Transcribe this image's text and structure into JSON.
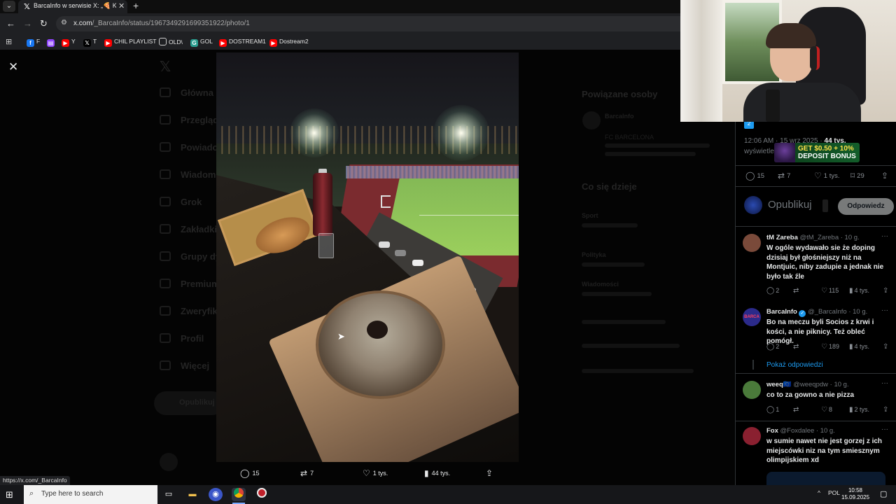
{
  "browser": {
    "tab_title": "BarcaInfo w serwisie X: „🍕 Kib",
    "new_tab_label": "+",
    "url_domain": "x.com",
    "url_path": "/_BarcaInfo/status/1967349291699351922/photo/1",
    "bookmarks": [
      {
        "label": "F",
        "icon_color": "#1877f2"
      },
      {
        "label": "",
        "icon_color": "#9146ff"
      },
      {
        "label": "Y",
        "icon_color": "#ff0000"
      },
      {
        "label": "T",
        "icon_color": "#000000"
      },
      {
        "label": "CHIL PLAYLIST",
        "icon_color": "#ff0000"
      },
      {
        "label": "OLD\\",
        "icon_color": "#555555"
      },
      {
        "label": "GOL",
        "icon_color": "#2a9d8f"
      },
      {
        "label": "DOSTREAM1",
        "icon_color": "#ff0000"
      },
      {
        "label": "Dostream2",
        "icon_color": "#ff0000"
      }
    ],
    "status_url": "https://x.com/_BarcaInfo"
  },
  "viewer": {
    "close_label": "✕",
    "actions": {
      "replies": "15",
      "reposts": "7",
      "likes": "1 tys.",
      "views": "44 tys."
    }
  },
  "background": {
    "nav_items": [
      "Główna",
      "Przeglądaj",
      "Powiadomienia",
      "Wiadomości",
      "Grok",
      "Zakładki",
      "Grupy dyskusyjne",
      "Premium",
      "Zweryfikowane",
      "Profil",
      "Więcej"
    ],
    "post_button": "Opublikuj",
    "right_titles": [
      "Powiązane osoby",
      "Co się dzieje"
    ],
    "right_rows": [
      "BarcaInfo",
      "FC BARCELONA",
      "Sport",
      "Polityka",
      "Wiadomości"
    ]
  },
  "panel": {
    "timestamp": "12:06 AM · 15 wrz 2025 ·",
    "views_count": "44 tys.",
    "views_label": "wyświetleń",
    "ad": {
      "line1": "GET $0.50 + 10%",
      "line2": "DEPOSIT BONUS"
    },
    "stats": {
      "replies": "15",
      "reposts": "7",
      "likes": "1 tys.",
      "bookmarks": "29"
    },
    "reply_placeholder": "Opublikuj",
    "reply_button": "Odpowiedz",
    "show_replies": "Pokaż odpowiedzi",
    "tweets": [
      {
        "name": "tM Zareba",
        "handle": "@tM_Zareba · 10 g.",
        "text": "W ogóle wydawało sie że doping dzisiaj był głośniejszy niż na Montjuic, niby zadupie a jednak nie było tak źle",
        "replies": "2",
        "reposts": "",
        "likes": "115",
        "views": "4 tys.",
        "avatar_color": "#7a4a3a"
      },
      {
        "name": "BarcaInfo",
        "handle": "@_BarcaInfo · 10 g.",
        "text": "Bo na meczu byli Socios z krwi i kości, a nie piknicy. Też obleć pomógł.",
        "replies": "2",
        "reposts": "",
        "likes": "189",
        "views": "4 tys.",
        "avatar_color": "#2b2a8a"
      },
      {
        "name": "weeq🇪🇺",
        "handle": "@weeqpdw · 10 g.",
        "text": "co to za gowno a nie pizza",
        "replies": "1",
        "reposts": "",
        "likes": "8",
        "views": "2 tys.",
        "avatar_color": "#4a7a3a"
      },
      {
        "name": "Fox",
        "handle": "@Foxdalee · 10 g.",
        "text": "w sumie nawet nie jest gorzej z ich miejscówki niz na tym smiesznym olimpijskiem xd",
        "replies": "",
        "reposts": "",
        "likes": "",
        "views": "",
        "avatar_color": "#8a2030"
      }
    ]
  },
  "taskbar": {
    "search_placeholder": "Type here to search",
    "tray_lang": "POL",
    "time": "10:58",
    "date": "15.09.2025"
  }
}
